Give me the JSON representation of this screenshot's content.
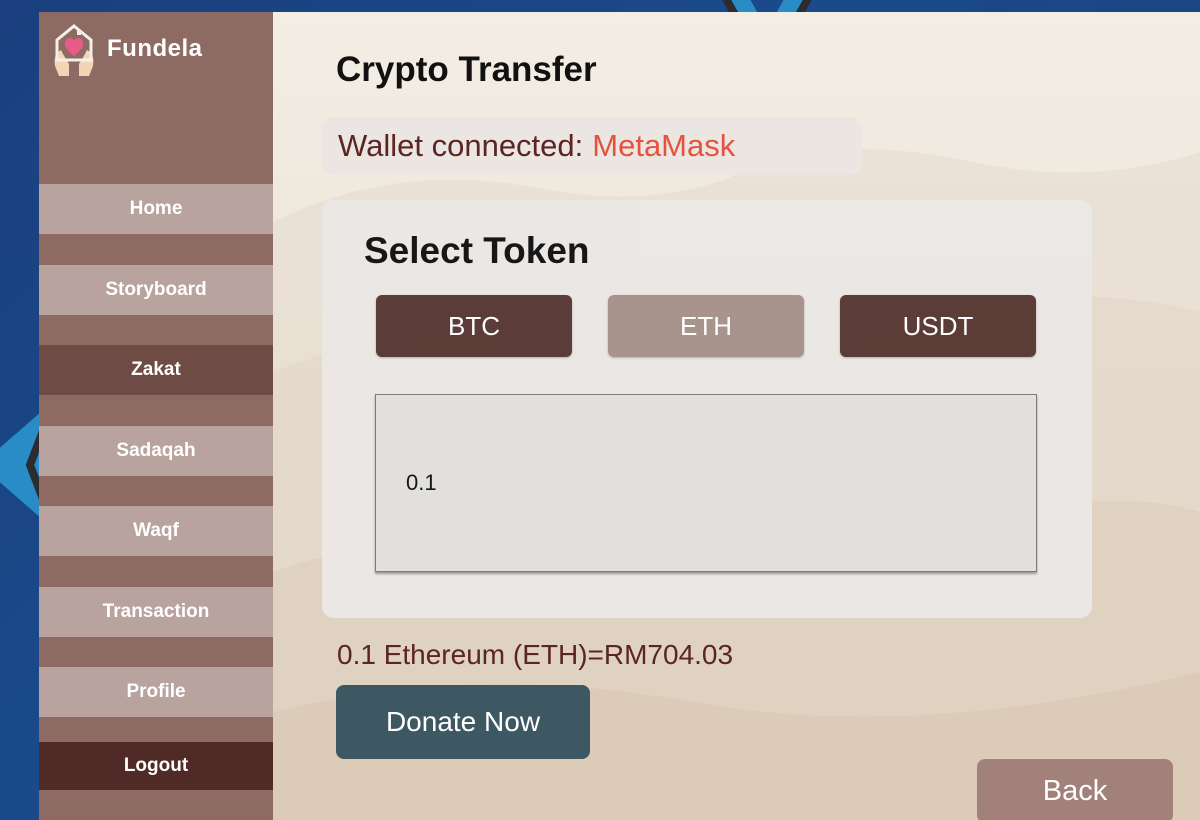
{
  "app": {
    "name": "Fundela"
  },
  "sidebar": {
    "items": [
      {
        "label": "Home"
      },
      {
        "label": "Storyboard"
      },
      {
        "label": "Zakat"
      },
      {
        "label": "Sadaqah"
      },
      {
        "label": "Waqf"
      },
      {
        "label": "Transaction"
      },
      {
        "label": "Profile"
      },
      {
        "label": "Logout"
      }
    ],
    "active": "Zakat"
  },
  "page": {
    "title": "Crypto Transfer"
  },
  "wallet": {
    "prefix": "Wallet connected:",
    "name": "MetaMask"
  },
  "token_select": {
    "title": "Select Token",
    "tokens": [
      {
        "label": "BTC",
        "selected": false
      },
      {
        "label": "ETH",
        "selected": true
      },
      {
        "label": "USDT",
        "selected": false
      }
    ],
    "amount": "0.1"
  },
  "conversion_text": "0.1 Ethereum (ETH)=RM704.03",
  "actions": {
    "donate_label": "Donate Now",
    "back_label": "Back"
  },
  "colors": {
    "sidebar_bg": "#8d6b62",
    "nav_item": "#b8a39e",
    "nav_active": "#6e4c45",
    "logout": "#4f2a26",
    "token_dark": "#573733",
    "token_selected": "#a6918b",
    "wallet_accent": "#e5533e",
    "donate": "#3d5763",
    "back": "#a3817b"
  }
}
